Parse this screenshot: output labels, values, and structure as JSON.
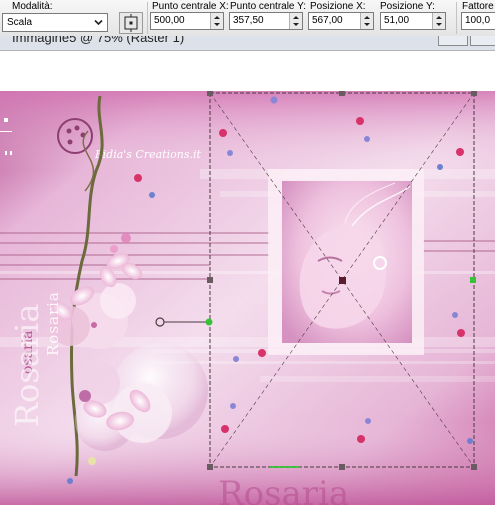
{
  "toolbar": {
    "mode": {
      "label": "Modalità:",
      "value": "Scala"
    },
    "center_x": {
      "label": "Punto centrale X:",
      "value": "500,00"
    },
    "center_y": {
      "label": "Punto centrale Y:",
      "value": "357,50"
    },
    "pos_x": {
      "label": "Posizione X:",
      "value": "567,00"
    },
    "pos_y": {
      "label": "Posizione Y:",
      "value": "51,00"
    },
    "factor": {
      "label": "Fattore",
      "value": "100,0"
    }
  },
  "window": {
    "title": "Immagine5 @ 75% (Raster 1)"
  },
  "artwork": {
    "signature": "Fidia's Creations.it",
    "name_vertical": "Rosaria",
    "name_main": "Rosaria",
    "name_small": "osaria",
    "bottom_name": "Rosaria"
  },
  "colors": {
    "accent": "#c2609e",
    "bead_red": "#d82b5b",
    "bead_blue": "#6d7fd0",
    "handle_green": "#38c238"
  }
}
